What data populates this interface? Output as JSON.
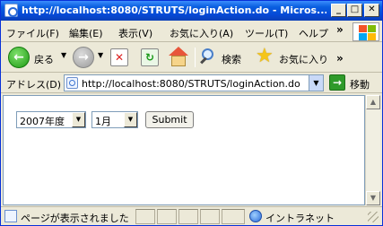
{
  "window": {
    "title": "http://localhost:8080/STRUTS/loginAction.do - Micros...",
    "min_glyph": "_",
    "max_glyph": "□",
    "close_glyph": "✕"
  },
  "menu": {
    "items": [
      "ファイル(F)",
      "編集(E)",
      "表示(V)",
      "お気に入り(A)",
      "ツール(T)",
      "ヘルプ"
    ],
    "more": "»"
  },
  "toolbar": {
    "back_label": "戻る",
    "search_label": "検索",
    "favorites_label": "お気に入り",
    "more": "»"
  },
  "address": {
    "label": "アドレス(D)",
    "url": "http://localhost:8080/STRUTS/loginAction.do",
    "go_label": "移動"
  },
  "form": {
    "year_selected": "2007年度",
    "month_selected": "1月",
    "submit_label": "Submit"
  },
  "status": {
    "text": "ページが表示されました",
    "zone": "イントラネット"
  }
}
